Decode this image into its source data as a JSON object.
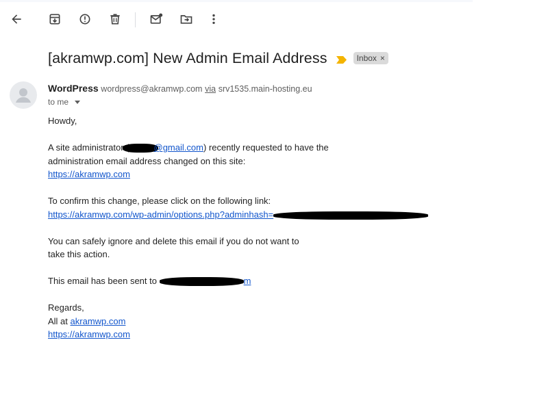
{
  "toolbar": {
    "buttons": [
      {
        "name": "back-button",
        "icon": "arrow-left-icon"
      },
      {
        "name": "archive-button",
        "icon": "archive-icon"
      },
      {
        "name": "report-spam-button",
        "icon": "report-icon"
      },
      {
        "name": "delete-button",
        "icon": "trash-icon"
      },
      {
        "name": "mark-unread-button",
        "icon": "mail-unread-icon"
      },
      {
        "name": "move-to-button",
        "icon": "move-folder-icon"
      },
      {
        "name": "more-button",
        "icon": "more-vert-icon"
      }
    ]
  },
  "email": {
    "subject": "[akramwp.com] New Admin Email Address",
    "label": "Inbox",
    "label_remove": "×",
    "sender_name": "WordPress",
    "sender_email": "wordpress@akramwp.com",
    "via_label": "via",
    "via_host": "srv1535.main-hosting.eu",
    "recipient": "to me",
    "body": {
      "greeting": "Howdy,",
      "p1_prefix": "A site administrator (",
      "p1_email_visible": "@gmail.com",
      "p1_suffix": ") recently requested to have the",
      "p1_line2": "administration email address changed on this site:",
      "site_link": "https://akramwp.com",
      "p2_line1": "To confirm this change, please click on the following link:",
      "confirm_link": "https://akramwp.com/wp-admin/options.php?adminhash=",
      "p3_line1": "You can safely ignore and delete this email if you do not want to",
      "p3_line2": "take this action.",
      "p4_prefix": "This email has been sent to",
      "p4_email_visible": "m",
      "regards": "Regards,",
      "all_at_prefix": "All at",
      "all_at_link": "akramwp.com",
      "footer_link": "https://akramwp.com"
    }
  },
  "colors": {
    "link": "#1155cc",
    "importance": "#f4b400",
    "label_bg": "#dadada"
  }
}
